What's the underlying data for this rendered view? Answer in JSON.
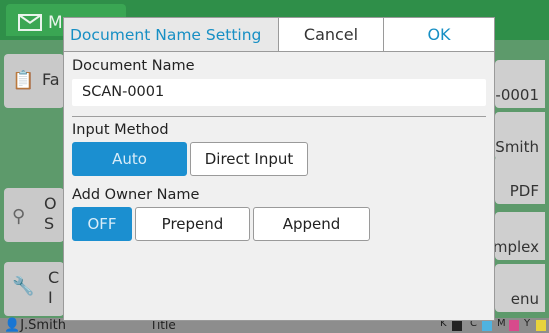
{
  "background": {
    "mail_tab_label": "Ma",
    "left_buttons": [
      {
        "label": "Fa",
        "icon": "favorites-icon"
      },
      {
        "label": "",
        "icon": ""
      },
      {
        "label": "O",
        "label2": "S",
        "icon": "search-icon"
      },
      {
        "label": "C",
        "label2": "I",
        "icon": "wrench-icon"
      }
    ],
    "right_buttons": [
      "-0001",
      "Smith",
      "PDF",
      "mplex",
      "enu"
    ],
    "status": {
      "user": "J.Smith",
      "title": "Title",
      "ink_labels": [
        "K",
        "C",
        "M",
        "Y"
      ]
    }
  },
  "dialog": {
    "title": "Document Name Setting",
    "cancel_label": "Cancel",
    "ok_label": "OK",
    "document_name": {
      "label": "Document Name",
      "value": "SCAN-0001"
    },
    "input_method": {
      "label": "Input Method",
      "options": [
        "Auto",
        "Direct Input"
      ],
      "selected": "Auto"
    },
    "add_owner_name": {
      "label": "Add Owner Name",
      "options": [
        "OFF",
        "Prepend",
        "Append"
      ],
      "selected": "OFF"
    }
  },
  "colors": {
    "accent": "#1b8fd0",
    "title_blue": "#178fc4",
    "app_green": "#2f8f49"
  }
}
